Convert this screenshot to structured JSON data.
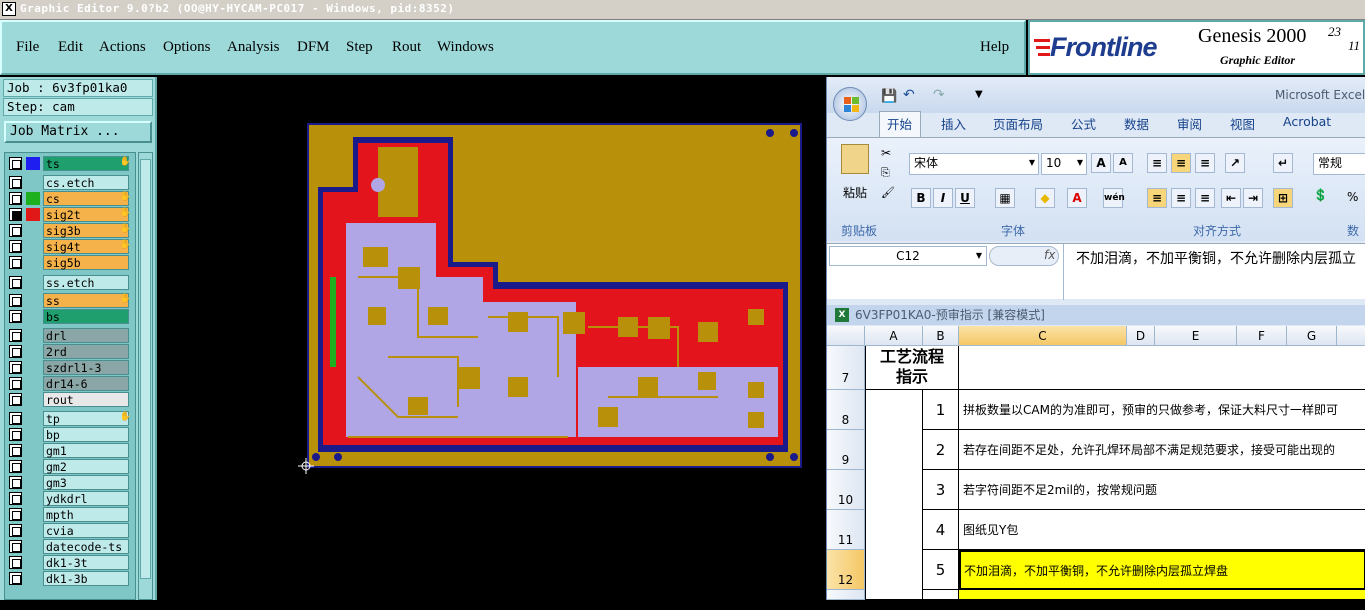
{
  "window": {
    "title": "Graphic Editor 9.0?b2 (OO@HY-HYCAM-PC017 - Windows, pid:8352)",
    "icon": "X"
  },
  "menu": {
    "items": [
      "File",
      "Edit",
      "Actions",
      "Options",
      "Analysis",
      "DFM",
      "Step",
      "Rout",
      "Windows"
    ],
    "help": "Help"
  },
  "logo": {
    "brand": "Frontline",
    "product": "Genesis 2000",
    "sub": "Graphic Editor",
    "version": "23",
    "version2": "11"
  },
  "sidebar": {
    "job": "Job : 6v3fp01ka0",
    "step": "Step: cam",
    "job_matrix": "Job Matrix ...",
    "layers": [
      {
        "name": "ts",
        "color": "#1f9e6e",
        "sw": "#1e1ef0",
        "on": false,
        "hand": true
      },
      {
        "name": "cs.etch",
        "color": "#bfeaea",
        "sw": "",
        "on": false,
        "hand": false
      },
      {
        "name": "cs",
        "color": "#f6b24a",
        "sw": "#1fb01f",
        "on": false,
        "hand": true
      },
      {
        "name": "sig2t",
        "color": "#f6b24a",
        "sw": "#e01818",
        "on": true,
        "hand": true
      },
      {
        "name": "sig3b",
        "color": "#f6b24a",
        "sw": "",
        "on": false,
        "hand": true
      },
      {
        "name": "sig4t",
        "color": "#f6b24a",
        "sw": "",
        "on": false,
        "hand": true
      },
      {
        "name": "sig5b",
        "color": "#f6b24a",
        "sw": "",
        "on": false,
        "hand": false
      },
      {
        "name": "ss.etch",
        "color": "#bfeaea",
        "sw": "",
        "on": false,
        "hand": false
      },
      {
        "name": "ss",
        "color": "#f6b24a",
        "sw": "",
        "on": false,
        "hand": true
      },
      {
        "name": "bs",
        "color": "#1f9e6e",
        "sw": "",
        "on": false,
        "hand": false
      },
      {
        "name": "drl",
        "color": "#8aa6a6",
        "sw": "",
        "on": false,
        "hand": false
      },
      {
        "name": "2rd",
        "color": "#8aa6a6",
        "sw": "",
        "on": false,
        "hand": false
      },
      {
        "name": "szdrl1-3",
        "color": "#8aa6a6",
        "sw": "",
        "on": false,
        "hand": false
      },
      {
        "name": "dr14-6",
        "color": "#8aa6a6",
        "sw": "",
        "on": false,
        "hand": false
      },
      {
        "name": "rout",
        "color": "#e8e8e8",
        "sw": "",
        "on": false,
        "hand": false
      },
      {
        "name": "tp",
        "color": "#bfeaea",
        "sw": "",
        "on": false,
        "hand": true
      },
      {
        "name": "bp",
        "color": "#bfeaea",
        "sw": "",
        "on": false,
        "hand": false
      },
      {
        "name": "gm1",
        "color": "#bfeaea",
        "sw": "",
        "on": false,
        "hand": false
      },
      {
        "name": "gm2",
        "color": "#bfeaea",
        "sw": "",
        "on": false,
        "hand": false
      },
      {
        "name": "gm3",
        "color": "#bfeaea",
        "sw": "",
        "on": false,
        "hand": false
      },
      {
        "name": "ydkdrl",
        "color": "#bfeaea",
        "sw": "",
        "on": false,
        "hand": false
      },
      {
        "name": "mpth",
        "color": "#bfeaea",
        "sw": "",
        "on": false,
        "hand": false
      },
      {
        "name": "cvia",
        "color": "#bfeaea",
        "sw": "",
        "on": false,
        "hand": false
      },
      {
        "name": "datecode-ts",
        "color": "#bfeaea",
        "sw": "",
        "on": false,
        "hand": false
      },
      {
        "name": "dk1-3t",
        "color": "#bfeaea",
        "sw": "",
        "on": false,
        "hand": false
      },
      {
        "name": "dk1-3b",
        "color": "#bfeaea",
        "sw": "",
        "on": false,
        "hand": false
      }
    ]
  },
  "excel": {
    "app_title": "Microsoft Excel",
    "tabs": [
      "开始",
      "插入",
      "页面布局",
      "公式",
      "数据",
      "审阅",
      "视图",
      "Acrobat"
    ],
    "font_name": "宋体",
    "font_size": "10",
    "number_format": "常规",
    "groups": [
      "剪贴板",
      "字体",
      "对齐方式",
      "数"
    ],
    "paste_label": "粘贴",
    "name_box": "C12",
    "fx": "fx",
    "formula": "不加泪滴，不加平衡铜，不允许删除内层孤立",
    "workbook_title": "6V3FP01KA0-预审指示  [兼容模式]",
    "columns": [
      "A",
      "B",
      "C",
      "D",
      "E",
      "F",
      "G"
    ],
    "header_label": "工艺流程指示",
    "rows": [
      {
        "row": "7",
        "num": "",
        "text": ""
      },
      {
        "row": "8",
        "num": "1",
        "text": "拼板数量以CAM的为准即可，预审的只做参考，保证大料尺寸一样即可"
      },
      {
        "row": "9",
        "num": "2",
        "text": "若存在间距不足处，允许孔焊环局部不满足规范要求，接受可能出现的"
      },
      {
        "row": "10",
        "num": "3",
        "text": "若字符间距不足2mil的，按常规问题"
      },
      {
        "row": "11",
        "num": "4",
        "text": "图纸见Y包"
      },
      {
        "row": "12",
        "num": "5",
        "text": "不加泪滴，不加平衡铜，不允许删除内层孤立焊盘"
      }
    ]
  }
}
